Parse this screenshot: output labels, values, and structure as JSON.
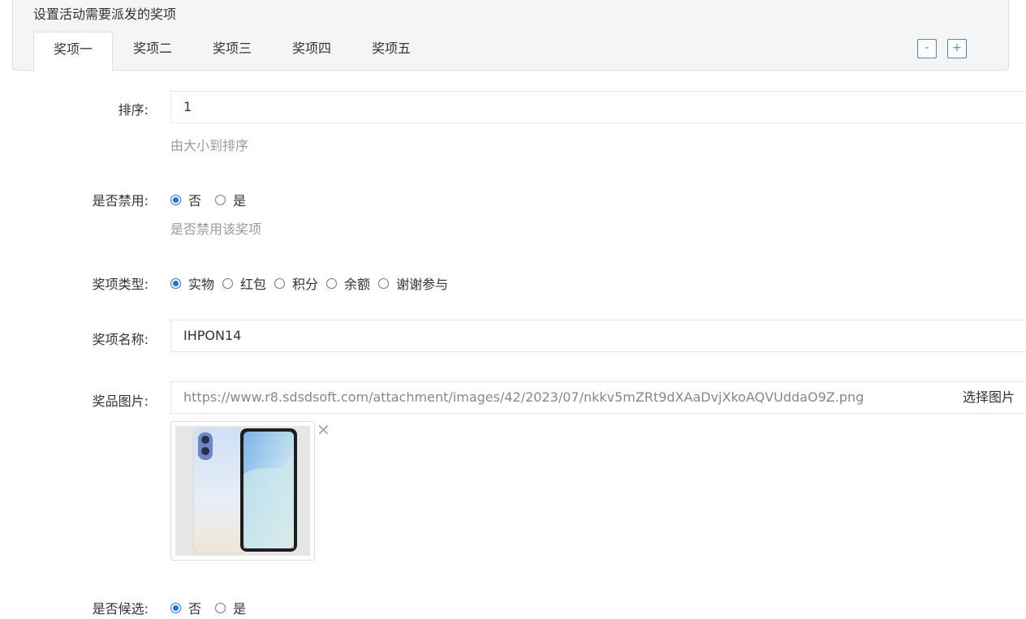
{
  "panel": {
    "title": "设置活动需要派发的奖项",
    "tabs": [
      "奖项一",
      "奖项二",
      "奖项三",
      "奖项四",
      "奖项五"
    ],
    "active_tab": 0,
    "minus_label": "-",
    "plus_label": "+"
  },
  "form": {
    "sort": {
      "label": "排序:",
      "value": "1",
      "help": "由大小到排序"
    },
    "disabled": {
      "label": "是否禁用:",
      "options": [
        "否",
        "是"
      ],
      "selected": "否",
      "help": "是否禁用该奖项"
    },
    "prize_type": {
      "label": "奖项类型:",
      "options": [
        "实物",
        "红包",
        "积分",
        "余额",
        "谢谢参与"
      ],
      "selected": "实物"
    },
    "prize_name": {
      "label": "奖项名称:",
      "value": "IHPON14"
    },
    "prize_image": {
      "label": "奖品图片:",
      "url": "https://www.r8.sdsdsoft.com/attachment/images/42/2023/07/nkkv5mZRt9dXAaDvjXkoAQVUddaO9Z.png",
      "choose_label": "选择图片",
      "remove_icon": "close-icon"
    },
    "candidate": {
      "label": "是否候选:",
      "options": [
        "否",
        "是"
      ],
      "selected": "否"
    }
  },
  "colors": {
    "accent": "#1a73e8",
    "button_border": "#3a8fd6",
    "help_text": "#999999"
  }
}
